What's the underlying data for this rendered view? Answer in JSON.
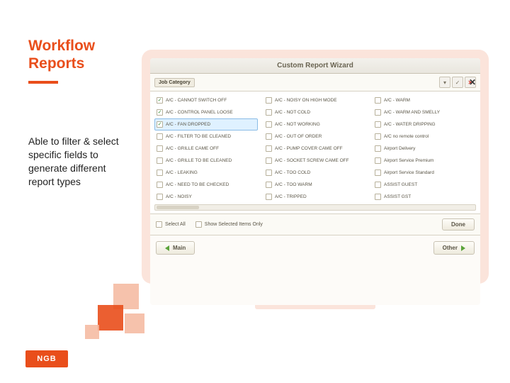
{
  "title_line1": "Workflow",
  "title_line2": "Reports",
  "description": "Able to filter & select specific fields to generate different report types",
  "wizard": {
    "title": "Custom Report Wizard",
    "category_chip": "Job Category",
    "close": "✕",
    "controls": {
      "dropdown": "▾",
      "check": "✓",
      "cancel": "✕"
    },
    "columns": [
      [
        {
          "label": "A/C - CANNOT SWITCH OFF",
          "checked": true
        },
        {
          "label": "A/C - CONTROL PANEL LOOSE",
          "checked": true
        },
        {
          "label": "A/C - FAN DROPPED",
          "checked": true,
          "selected": true
        },
        {
          "label": "A/C - FILTER TO BE CLEANED",
          "checked": false
        },
        {
          "label": "A/C - GRILLE CAME OFF",
          "checked": false
        },
        {
          "label": "A/C - GRILLE TO BE CLEANED",
          "checked": false
        },
        {
          "label": "A/C - LEAKING",
          "checked": false
        },
        {
          "label": "A/C - NEED TO BE CHECKED",
          "checked": false
        },
        {
          "label": "A/C - NOISY",
          "checked": false
        }
      ],
      [
        {
          "label": "A/C - NOISY ON HIGH MODE",
          "checked": false
        },
        {
          "label": "A/C - NOT COLD",
          "checked": false
        },
        {
          "label": "A/C - NOT WORKING",
          "checked": false
        },
        {
          "label": "A/C - OUT OF ORDER",
          "checked": false
        },
        {
          "label": "A/C - PUMP COVER CAME OFF",
          "checked": false
        },
        {
          "label": "A/C - SOCKET SCREW CAME OFF",
          "checked": false
        },
        {
          "label": "A/C - TOO COLD",
          "checked": false
        },
        {
          "label": "A/C - TOO WARM",
          "checked": false
        },
        {
          "label": "A/C - TRIPPED",
          "checked": false
        }
      ],
      [
        {
          "label": "A/C - WARM",
          "checked": false
        },
        {
          "label": "A/C - WARM AND SMELLY",
          "checked": false
        },
        {
          "label": "A/C - WATER DRIPPING",
          "checked": false
        },
        {
          "label": "A/C no remote control",
          "checked": false
        },
        {
          "label": "Airport Delivery",
          "checked": false
        },
        {
          "label": "Airport Service Premium",
          "checked": false
        },
        {
          "label": "Airport Service Standard",
          "checked": false
        },
        {
          "label": "ASSIST GUEST",
          "checked": false
        },
        {
          "label": "ASSIST GST",
          "checked": false
        }
      ]
    ],
    "select_all_label": "Select All",
    "select_all_checked": false,
    "show_selected_label": "Show Selected Items Only",
    "show_selected_checked": false,
    "done_label": "Done",
    "nav_back": "Main",
    "nav_next": "Other"
  },
  "logo_text": "NGB"
}
